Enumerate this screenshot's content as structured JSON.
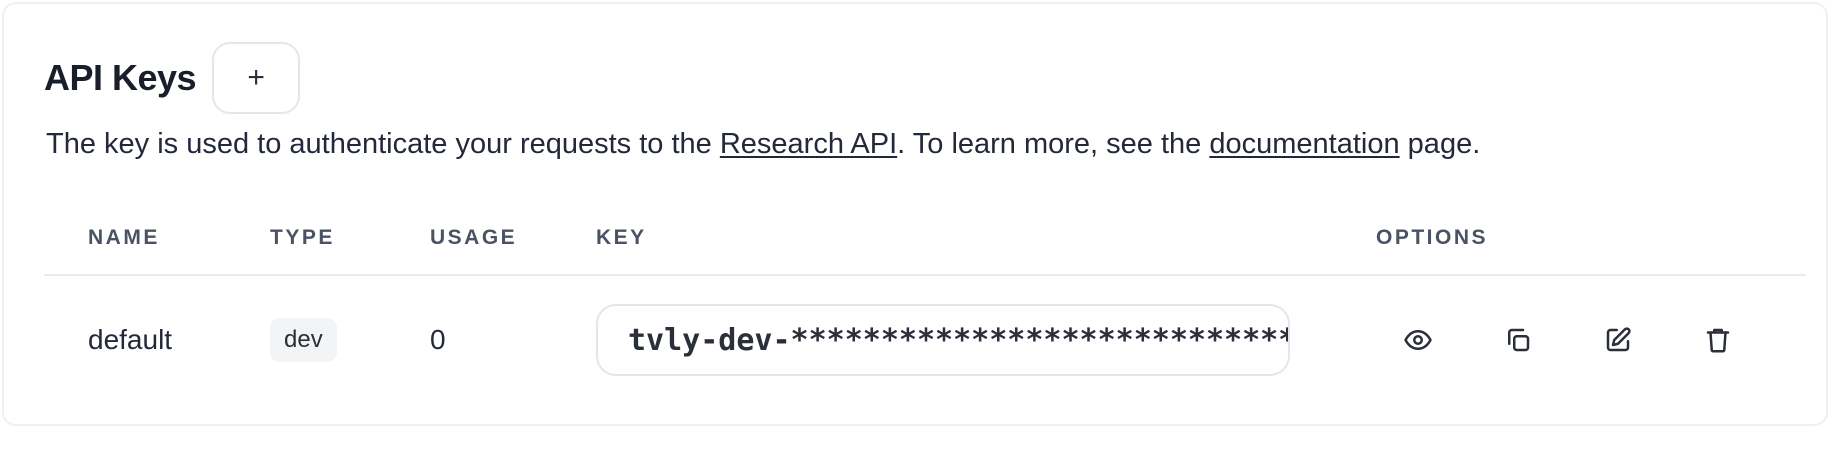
{
  "section": {
    "title": "API Keys",
    "add_label": "+"
  },
  "description": {
    "before": "The key is used to authenticate your requests to the ",
    "link1": "Research API",
    "middle": ". To learn more, see the ",
    "link2": "documentation",
    "after": " page."
  },
  "table": {
    "columns": [
      "NAME",
      "TYPE",
      "USAGE",
      "KEY",
      "OPTIONS"
    ],
    "rows": [
      {
        "name": "default",
        "type": "dev",
        "usage": "0",
        "key": "tvly-dev-****************************************"
      }
    ]
  },
  "icons": {
    "view": "eye-icon",
    "copy": "copy-icon",
    "edit": "edit-icon",
    "delete": "trash-icon"
  }
}
